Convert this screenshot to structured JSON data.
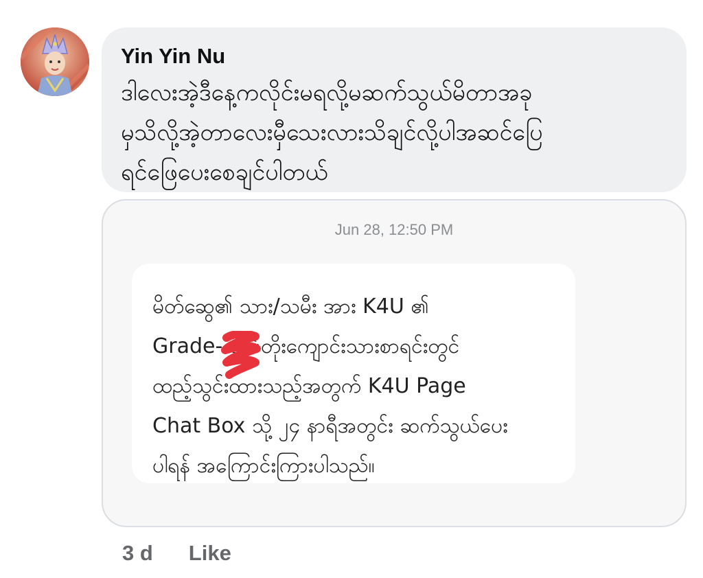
{
  "comment": {
    "author": "Yin Yin Nu",
    "text": "ဒါလေးအဲ့ဒီနေ့ကလိုင်းမရလို့မဆက်သွယ်မိတာအခု\nမှသိလို့အဲ့တာလေးမှီသေးလားသိချင်လို့ပါအဆင်ပြေ\nရင်ဖြေပေးစေချင်ပါတယ်"
  },
  "attachment": {
    "timestamp": "Jun 28, 12:50 PM",
    "message": "မိတ်ဆွေ၏ သား/သမီး အား K4U ၏\nGrade-  ထပ်တိုးကျောင်းသားစာရင်းတွင်\nထည့်သွင်းထားသည့်အတွက် K4U Page\nChat Box သို့ ၂၄ နာရီအတွင်း ဆက်သွယ်ပေး\nပါရန် အကြောင်းကြားပါသည်။"
  },
  "footer": {
    "time": "3 d",
    "like_label": "Like"
  },
  "colors": {
    "comment_bg": "#eff0f2",
    "card_border": "#dadde1",
    "meta_text": "#65676b",
    "redaction": "#e8323c"
  },
  "icons": {
    "avatar": "profile-avatar",
    "redaction": "red-scribble-redaction"
  }
}
